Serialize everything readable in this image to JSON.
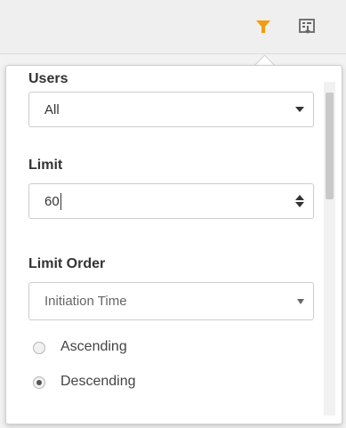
{
  "toolbar": {
    "filter_icon": "filter-icon",
    "export_icon": "export-icon",
    "accent_color": "#f39c12"
  },
  "filter_panel": {
    "users": {
      "label": "Users",
      "value": "All"
    },
    "limit": {
      "label": "Limit",
      "value": "60"
    },
    "limit_order": {
      "label": "Limit Order",
      "value": "Initiation Time",
      "options": [
        {
          "label": "Ascending",
          "checked": false
        },
        {
          "label": "Descending",
          "checked": true
        }
      ]
    }
  }
}
